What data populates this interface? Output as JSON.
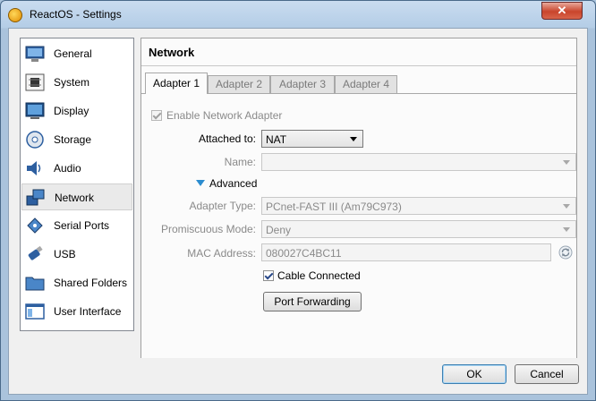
{
  "window": {
    "title": "ReactOS - Settings",
    "close_glyph": "✕"
  },
  "sidebar": {
    "items": [
      {
        "label": "General",
        "icon": "general-icon"
      },
      {
        "label": "System",
        "icon": "system-icon"
      },
      {
        "label": "Display",
        "icon": "display-icon"
      },
      {
        "label": "Storage",
        "icon": "storage-icon"
      },
      {
        "label": "Audio",
        "icon": "audio-icon"
      },
      {
        "label": "Network",
        "icon": "network-icon",
        "selected": true
      },
      {
        "label": "Serial Ports",
        "icon": "serial-ports-icon"
      },
      {
        "label": "USB",
        "icon": "usb-icon"
      },
      {
        "label": "Shared Folders",
        "icon": "shared-folders-icon"
      },
      {
        "label": "User Interface",
        "icon": "user-interface-icon"
      }
    ]
  },
  "content": {
    "title": "Network",
    "tabs": [
      {
        "label": "Adapter 1",
        "active": true
      },
      {
        "label": "Adapter 2"
      },
      {
        "label": "Adapter 3"
      },
      {
        "label": "Adapter 4"
      }
    ],
    "enable_adapter": {
      "label": "Enable Network Adapter",
      "checked": true,
      "enabled": false
    },
    "attached_to": {
      "label": "Attached to:",
      "value": "NAT"
    },
    "name": {
      "label": "Name:",
      "value": ""
    },
    "advanced": {
      "label": "Advanced",
      "expanded": true
    },
    "adapter_type": {
      "label": "Adapter Type:",
      "value": "PCnet-FAST III (Am79C973)"
    },
    "promiscuous_mode": {
      "label": "Promiscuous Mode:",
      "value": "Deny"
    },
    "mac_address": {
      "label": "MAC Address:",
      "value": "080027C4BC11"
    },
    "cable_connected": {
      "label": "Cable Connected",
      "checked": true
    },
    "port_forwarding": {
      "label": "Port Forwarding"
    }
  },
  "footer": {
    "ok_label": "OK",
    "cancel_label": "Cancel"
  },
  "colors": {
    "accent": "#2b8ccf",
    "title_bar": "#b4cde6",
    "close_button": "#c9452c"
  }
}
